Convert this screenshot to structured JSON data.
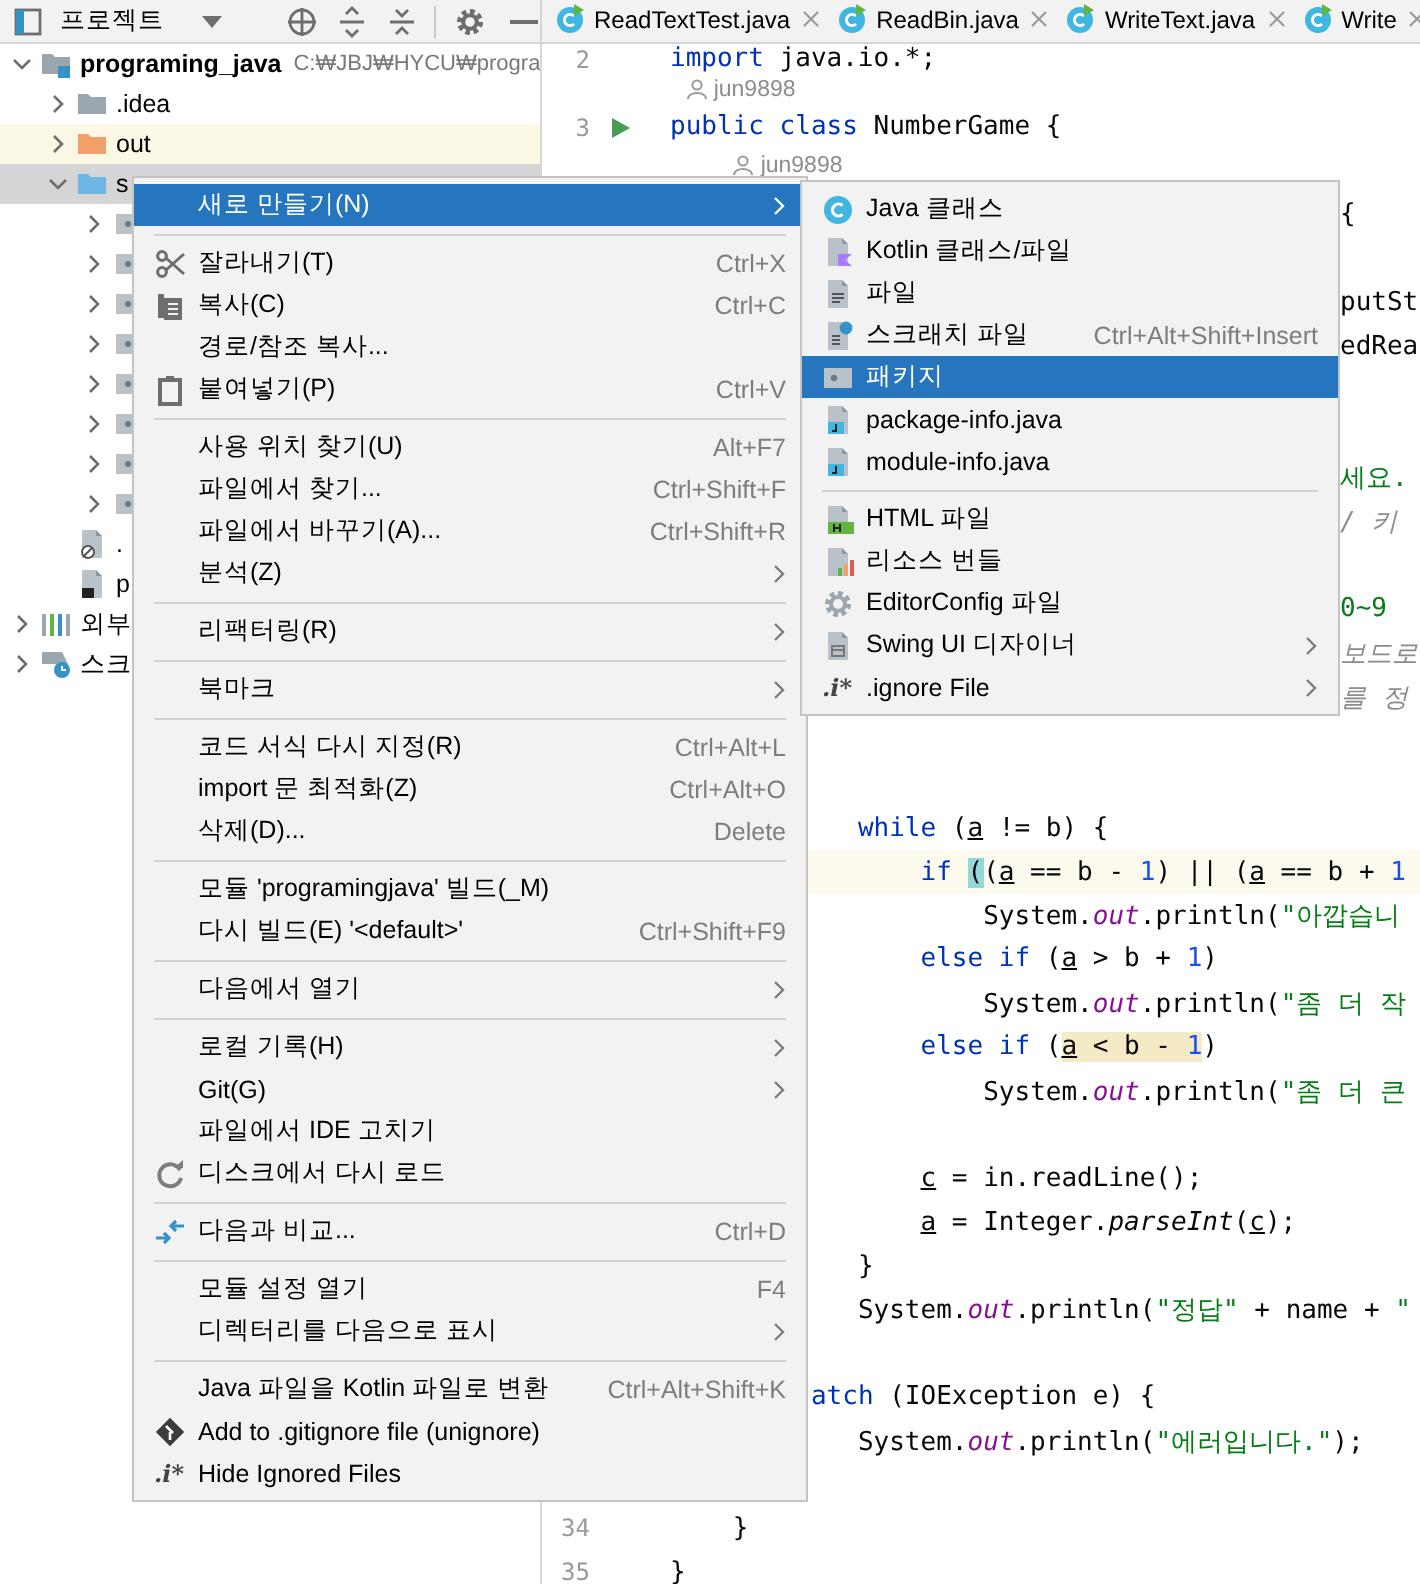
{
  "toolbar": {
    "title": "프로젝트"
  },
  "tabs": [
    {
      "label": "ReadTextTest.java",
      "selected": false
    },
    {
      "label": "ReadBin.java",
      "selected": false
    },
    {
      "label": "WriteText.java",
      "selected": false
    },
    {
      "label": "Write",
      "selected": false
    }
  ],
  "tree": [
    {
      "label": "programing_java",
      "detail": "C:₩JBJ₩HYCU₩progra",
      "kind": "module",
      "expanded": true,
      "selected": false,
      "children": [
        {
          "label": ".idea",
          "kind": "folder",
          "expanded": false,
          "selected": false
        },
        {
          "label": "out",
          "kind": "excluded-folder",
          "expanded": false,
          "selected": false
        },
        {
          "label": "s",
          "kind": "source-folder",
          "expanded": true,
          "selected": true,
          "children": [
            {
              "kind": "package",
              "expanded": false
            },
            {
              "kind": "package",
              "expanded": false
            },
            {
              "kind": "package",
              "expanded": false
            },
            {
              "kind": "package",
              "expanded": false
            },
            {
              "kind": "package",
              "expanded": false
            },
            {
              "kind": "package",
              "expanded": false
            },
            {
              "kind": "package",
              "expanded": false
            },
            {
              "kind": "package",
              "expanded": false
            }
          ]
        },
        {
          "label": ".",
          "kind": "ignore-file",
          "selected": false
        },
        {
          "label": "p",
          "kind": "module-file",
          "selected": false
        }
      ]
    },
    {
      "label": "외부",
      "kind": "libraries",
      "expanded": false,
      "selected": false
    },
    {
      "label": "스크",
      "kind": "scratches",
      "expanded": false,
      "selected": false
    }
  ],
  "editor": {
    "rows": [
      {
        "kind": "code",
        "number": "2",
        "current": false,
        "tokens": [
          {
            "text": "import",
            "kind": "kw"
          },
          {
            "text": " java.io.*;",
            "kind": "plain"
          }
        ]
      },
      {
        "kind": "hint",
        "text": " jun9898"
      },
      {
        "kind": "runnable",
        "number": "3",
        "current": false,
        "tokens": [
          {
            "text": "public",
            "kind": "kw"
          },
          {
            "text": " class",
            "kind": "kw"
          },
          {
            "text": " NumberGame {",
            "kind": "plain"
          }
        ]
      },
      {
        "kind": "hint",
        "text": "    jun9898"
      },
      {
        "kind": "tail",
        "tokens": [
          {
            "text": "{",
            "kind": "plain"
          }
        ]
      },
      {
        "kind": "blank"
      },
      {
        "kind": "tail",
        "tokens": [
          {
            "text": "putSt",
            "kind": "plain"
          }
        ]
      },
      {
        "kind": "tail",
        "tokens": [
          {
            "text": "edRea",
            "kind": "plain"
          }
        ]
      },
      {
        "kind": "blank"
      },
      {
        "kind": "blank"
      },
      {
        "kind": "tail",
        "tokens": [
          {
            "text": "세요.",
            "kind": "str"
          }
        ]
      },
      {
        "kind": "tail",
        "tokens": [
          {
            "text": "/ 키",
            "kind": "comment"
          }
        ]
      },
      {
        "kind": "blank"
      },
      {
        "kind": "tail",
        "tokens": [
          {
            "text": "0~9",
            "kind": "str"
          }
        ]
      },
      {
        "kind": "tail",
        "tokens": [
          {
            "text": "보드로",
            "kind": "comment"
          }
        ]
      },
      {
        "kind": "tail",
        "tokens": [
          {
            "text": "를 정",
            "kind": "comment"
          }
        ]
      },
      {
        "kind": "blank"
      },
      {
        "kind": "blank"
      },
      {
        "kind": "code",
        "current": false,
        "tokens": [
          {
            "text": "            while",
            "kind": "kw"
          },
          {
            "text": " (",
            "kind": "plain"
          },
          {
            "text": "a",
            "kind": "var"
          },
          {
            "text": " != b) {",
            "kind": "plain"
          }
        ]
      },
      {
        "kind": "code",
        "current": true,
        "tokens": [
          {
            "text": "                if ",
            "kind": "kw"
          },
          {
            "text": "(",
            "kind": "match"
          },
          {
            "text": "(",
            "kind": "plain"
          },
          {
            "text": "a",
            "kind": "var"
          },
          {
            "text": " == b - ",
            "kind": "plain"
          },
          {
            "text": "1",
            "kind": "num"
          },
          {
            "text": ") || (",
            "kind": "plain"
          },
          {
            "text": "a",
            "kind": "var"
          },
          {
            "text": " == b + ",
            "kind": "plain"
          },
          {
            "text": "1",
            "kind": "num"
          }
        ]
      },
      {
        "kind": "code",
        "current": false,
        "tokens": [
          {
            "text": "                    System.",
            "kind": "plain"
          },
          {
            "text": "out",
            "kind": "field"
          },
          {
            "text": ".println(",
            "kind": "plain"
          },
          {
            "text": "\"아깝습니",
            "kind": "str"
          }
        ]
      },
      {
        "kind": "code",
        "current": false,
        "tokens": [
          {
            "text": "                else if",
            "kind": "kw"
          },
          {
            "text": " (",
            "kind": "plain"
          },
          {
            "text": "a",
            "kind": "var"
          },
          {
            "text": " > b + ",
            "kind": "plain"
          },
          {
            "text": "1",
            "kind": "num"
          },
          {
            "text": ")",
            "kind": "plain"
          }
        ]
      },
      {
        "kind": "code",
        "current": false,
        "tokens": [
          {
            "text": "                    System.",
            "kind": "plain"
          },
          {
            "text": "out",
            "kind": "field"
          },
          {
            "text": ".println(",
            "kind": "plain"
          },
          {
            "text": "\"좀 더 작",
            "kind": "str"
          }
        ]
      },
      {
        "kind": "code",
        "current": false,
        "tokens": [
          {
            "text": "                else if",
            "kind": "kw"
          },
          {
            "text": " (",
            "kind": "plain"
          },
          {
            "text": "a",
            "kind": "var-range"
          },
          {
            "text": " < b - ",
            "kind": "plain-range"
          },
          {
            "text": "1",
            "kind": "num-range"
          },
          {
            "text": ")",
            "kind": "plain"
          }
        ]
      },
      {
        "kind": "code",
        "current": false,
        "tokens": [
          {
            "text": "                    System.",
            "kind": "plain"
          },
          {
            "text": "out",
            "kind": "field"
          },
          {
            "text": ".println(",
            "kind": "plain"
          },
          {
            "text": "\"좀 더 큰",
            "kind": "str"
          }
        ]
      },
      {
        "kind": "blank"
      },
      {
        "kind": "code",
        "current": false,
        "tokens": [
          {
            "text": "                c",
            "kind": "var"
          },
          {
            "text": " = in.readLine();",
            "kind": "plain"
          }
        ]
      },
      {
        "kind": "code",
        "current": false,
        "tokens": [
          {
            "text": "                a",
            "kind": "var"
          },
          {
            "text": " = Integer.",
            "kind": "plain"
          },
          {
            "text": "parseInt",
            "kind": "static"
          },
          {
            "text": "(",
            "kind": "plain"
          },
          {
            "text": "c",
            "kind": "var"
          },
          {
            "text": ");",
            "kind": "plain"
          }
        ]
      },
      {
        "kind": "code",
        "current": false,
        "tokens": [
          {
            "text": "            }",
            "kind": "plain"
          }
        ]
      },
      {
        "kind": "code",
        "current": false,
        "tokens": [
          {
            "text": "            System.",
            "kind": "plain"
          },
          {
            "text": "out",
            "kind": "field"
          },
          {
            "text": ".println(",
            "kind": "plain"
          },
          {
            "text": "\"정답\"",
            "kind": "str"
          },
          {
            "text": " + name + ",
            "kind": "plain"
          },
          {
            "text": "\"",
            "kind": "str"
          }
        ]
      },
      {
        "kind": "blank"
      },
      {
        "kind": "code",
        "current": false,
        "tokens": [
          {
            "text": "         atch",
            "kind": "kw"
          },
          {
            "text": " (IOException e) {",
            "kind": "plain"
          }
        ]
      },
      {
        "kind": "code",
        "current": false,
        "tokens": [
          {
            "text": "            System.",
            "kind": "plain"
          },
          {
            "text": "out",
            "kind": "field"
          },
          {
            "text": ".println(",
            "kind": "plain"
          },
          {
            "text": "\"에러입니다.\"",
            "kind": "str"
          },
          {
            "text": ");",
            "kind": "plain"
          }
        ]
      },
      {
        "kind": "blank"
      },
      {
        "kind": "code",
        "number": "34",
        "current": false,
        "tokens": [
          {
            "text": "    }",
            "kind": "plain"
          }
        ]
      },
      {
        "kind": "code",
        "number": "35",
        "current": false,
        "tokens": [
          {
            "text": "}",
            "kind": "plain"
          }
        ]
      }
    ]
  },
  "context_menu": {
    "items": [
      {
        "kind": "text",
        "label": "새로 만들기(N)",
        "submenu": true,
        "selected": true
      },
      {
        "kind": "separator"
      },
      {
        "kind": "cut",
        "label": "잘라내기(T)",
        "shortcut": "Ctrl+X",
        "selected": false
      },
      {
        "kind": "copy",
        "label": "복사(C)",
        "shortcut": "Ctrl+C",
        "selected": false
      },
      {
        "kind": "text",
        "label": "경로/참조 복사...",
        "selected": false
      },
      {
        "kind": "paste",
        "label": "붙여넣기(P)",
        "shortcut": "Ctrl+V",
        "selected": false
      },
      {
        "kind": "separator"
      },
      {
        "kind": "text",
        "label": "사용 위치 찾기(U)",
        "shortcut": "Alt+F7",
        "selected": false
      },
      {
        "kind": "text",
        "label": "파일에서 찾기...",
        "shortcut": "Ctrl+Shift+F",
        "selected": false
      },
      {
        "kind": "text",
        "label": "파일에서 바꾸기(A)...",
        "shortcut": "Ctrl+Shift+R",
        "selected": false
      },
      {
        "kind": "text",
        "label": "분석(Z)",
        "submenu": true,
        "selected": false
      },
      {
        "kind": "separator"
      },
      {
        "kind": "text",
        "label": "리팩터링(R)",
        "submenu": true,
        "selected": false
      },
      {
        "kind": "separator"
      },
      {
        "kind": "text",
        "label": "북마크",
        "submenu": true,
        "selected": false
      },
      {
        "kind": "separator"
      },
      {
        "kind": "text",
        "label": "코드 서식 다시 지정(R)",
        "shortcut": "Ctrl+Alt+L",
        "selected": false
      },
      {
        "kind": "text",
        "label": "import 문 최적화(Z)",
        "shortcut": "Ctrl+Alt+O",
        "selected": false
      },
      {
        "kind": "text",
        "label": "삭제(D)...",
        "shortcut": "Delete",
        "selected": false
      },
      {
        "kind": "separator"
      },
      {
        "kind": "text",
        "label": "모듈 'programingjava' 빌드(_M)",
        "selected": false
      },
      {
        "kind": "text",
        "label": "다시 빌드(E) '<default>'",
        "shortcut": "Ctrl+Shift+F9",
        "selected": false
      },
      {
        "kind": "separator"
      },
      {
        "kind": "text",
        "label": "다음에서 열기",
        "submenu": true,
        "selected": false
      },
      {
        "kind": "separator"
      },
      {
        "kind": "text",
        "label": "로컬 기록(H)",
        "submenu": true,
        "selected": false
      },
      {
        "kind": "text",
        "label": "Git(G)",
        "submenu": true,
        "selected": false
      },
      {
        "kind": "text",
        "label": "파일에서 IDE 고치기",
        "selected": false
      },
      {
        "kind": "reload",
        "label": "디스크에서 다시 로드",
        "selected": false
      },
      {
        "kind": "separator"
      },
      {
        "kind": "compare",
        "label": "다음과 비교...",
        "shortcut": "Ctrl+D",
        "selected": false
      },
      {
        "kind": "separator"
      },
      {
        "kind": "text",
        "label": "모듈 설정 열기",
        "shortcut": "F4",
        "selected": false
      },
      {
        "kind": "text",
        "label": "디렉터리를 다음으로 표시",
        "submenu": true,
        "selected": false
      },
      {
        "kind": "separator"
      },
      {
        "kind": "text",
        "label": "Java 파일을 Kotlin 파일로 변환",
        "shortcut": "Ctrl+Alt+Shift+K",
        "selected": false
      },
      {
        "kind": "git",
        "label": "Add to .gitignore file (unignore)",
        "selected": false
      },
      {
        "kind": "ignore",
        "label": "Hide Ignored Files",
        "icon_text": ".i*",
        "selected": false
      }
    ]
  },
  "submenu": {
    "items": [
      {
        "kind": "class",
        "label": "Java 클래스",
        "selected": false
      },
      {
        "kind": "kotlin",
        "label": "Kotlin 클래스/파일",
        "selected": false
      },
      {
        "kind": "file",
        "label": "파일",
        "selected": false
      },
      {
        "kind": "scratch",
        "label": "스크래치 파일",
        "shortcut": "Ctrl+Alt+Shift+Insert",
        "selected": false
      },
      {
        "kind": "package",
        "label": "패키지",
        "selected": true
      },
      {
        "kind": "javafile",
        "label": "package-info.java",
        "selected": false
      },
      {
        "kind": "javafile",
        "label": "module-info.java",
        "selected": false
      },
      {
        "kind": "separator"
      },
      {
        "kind": "html",
        "label": "HTML 파일",
        "selected": false
      },
      {
        "kind": "bundle",
        "label": "리소스 번들",
        "selected": false
      },
      {
        "kind": "editorconfig",
        "label": "EditorConfig 파일",
        "selected": false
      },
      {
        "kind": "form",
        "label": "Swing UI 디자이너",
        "submenu": true,
        "selected": false
      },
      {
        "kind": "ignore",
        "label": ".ignore File",
        "icon_text": ".i*",
        "submenu": true,
        "selected": false
      }
    ]
  }
}
